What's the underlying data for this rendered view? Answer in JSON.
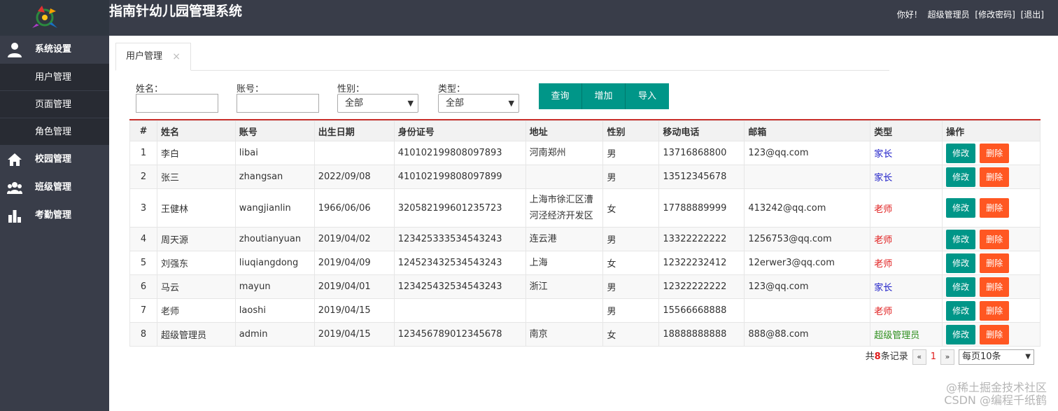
{
  "app": {
    "title": "指南针幼儿园管理系统"
  },
  "topbar": {
    "greeting": "你好！",
    "user": "超级管理员",
    "change_pwd": "[修改密码]",
    "logout": "[退出]"
  },
  "sidebar": {
    "groups": [
      {
        "label": "系统设置",
        "icon": "user-icon"
      },
      {
        "label": "校园管理",
        "icon": "home-icon"
      },
      {
        "label": "班级管理",
        "icon": "group-icon"
      },
      {
        "label": "考勤管理",
        "icon": "bar-chart-icon"
      }
    ],
    "sub_items": [
      "用户管理",
      "页面管理",
      "角色管理"
    ]
  },
  "tab": {
    "label": "用户管理",
    "close": "×"
  },
  "search": {
    "name_label": "姓名：",
    "account_label": "账号：",
    "gender_label": "性别：",
    "gender_value": "全部",
    "type_label": "类型：",
    "type_value": "全部"
  },
  "buttons": {
    "query": "查询",
    "add": "增加",
    "import": "导入"
  },
  "table": {
    "headers": [
      "#",
      "姓名",
      "账号",
      "出生日期",
      "身份证号",
      "地址",
      "性别",
      "移动电话",
      "邮箱",
      "类型",
      "操作"
    ],
    "rows": [
      {
        "no": "1",
        "name": "李白",
        "account": "libai",
        "birth": "",
        "id": "410102199808097893",
        "addr1": "河南郑州",
        "addr2": "",
        "gender": "男",
        "phone": "13716868800",
        "email": "123@qq.com",
        "type": "家长"
      },
      {
        "no": "2",
        "name": "张三",
        "account": "zhangsan",
        "birth": "2022/09/08",
        "id": "410102199808097899",
        "addr1": "",
        "addr2": "",
        "gender": "男",
        "phone": "13512345678",
        "email": "",
        "type": "家长"
      },
      {
        "no": "3",
        "name": "王健林",
        "account": "wangjianlin",
        "birth": "1966/06/06",
        "id": "320582199601235723",
        "addr1": "上海市徐汇区漕",
        "addr2": "河泾经济开发区",
        "gender": "女",
        "phone": "17788889999",
        "email": "413242@qq.com",
        "type": "老师"
      },
      {
        "no": "4",
        "name": "周天源",
        "account": "zhoutianyuan",
        "birth": "2019/04/02",
        "id": "123425333534543243",
        "addr1": "连云港",
        "addr2": "",
        "gender": "男",
        "phone": "13322222222",
        "email": "1256753@qq.com",
        "type": "老师"
      },
      {
        "no": "5",
        "name": "刘强东",
        "account": "liuqiangdong",
        "birth": "2019/04/09",
        "id": "124523432534543243",
        "addr1": "上海",
        "addr2": "",
        "gender": "女",
        "phone": "12322232412",
        "email": "12erwer3@qq.com",
        "type": "老师"
      },
      {
        "no": "6",
        "name": "马云",
        "account": "mayun",
        "birth": "2019/04/01",
        "id": "123425432534543243",
        "addr1": "浙江",
        "addr2": "",
        "gender": "男",
        "phone": "12322222222",
        "email": "123@qq.com",
        "type": "家长"
      },
      {
        "no": "7",
        "name": "老师",
        "account": "laoshi",
        "birth": "2019/04/15",
        "id": "",
        "addr1": "",
        "addr2": "",
        "gender": "男",
        "phone": "15566668888",
        "email": "",
        "type": "老师"
      },
      {
        "no": "8",
        "name": "超级管理员",
        "account": "admin",
        "birth": "2019/04/15",
        "id": "123456789012345678",
        "addr1": "南京",
        "addr2": "",
        "gender": "女",
        "phone": "18888888888",
        "email": "888@88.com",
        "type": "超级管理员"
      }
    ],
    "edit_label": "修改",
    "delete_label": "删除"
  },
  "pager": {
    "total_prefix": "共",
    "total": "8",
    "total_suffix": "条记录",
    "prev": "«",
    "page": "1",
    "next": "»",
    "per_page": "每页10条"
  },
  "watermark": {
    "line1": "@稀土掘金技术社区",
    "line2": "CSDN @编程千纸鹤"
  },
  "colors": {
    "sidebar": "#393d49",
    "accent": "#009688",
    "danger": "#ff5722",
    "table_top_border": "#c9302c"
  }
}
